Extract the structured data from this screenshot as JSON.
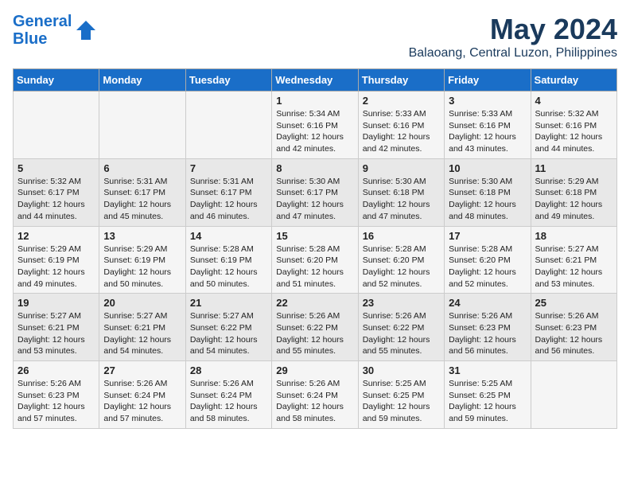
{
  "header": {
    "logo_line1": "General",
    "logo_line2": "Blue",
    "month": "May 2024",
    "location": "Balaoang, Central Luzon, Philippines"
  },
  "days_of_week": [
    "Sunday",
    "Monday",
    "Tuesday",
    "Wednesday",
    "Thursday",
    "Friday",
    "Saturday"
  ],
  "weeks": [
    [
      {
        "num": "",
        "info": ""
      },
      {
        "num": "",
        "info": ""
      },
      {
        "num": "",
        "info": ""
      },
      {
        "num": "1",
        "info": "Sunrise: 5:34 AM\nSunset: 6:16 PM\nDaylight: 12 hours\nand 42 minutes."
      },
      {
        "num": "2",
        "info": "Sunrise: 5:33 AM\nSunset: 6:16 PM\nDaylight: 12 hours\nand 42 minutes."
      },
      {
        "num": "3",
        "info": "Sunrise: 5:33 AM\nSunset: 6:16 PM\nDaylight: 12 hours\nand 43 minutes."
      },
      {
        "num": "4",
        "info": "Sunrise: 5:32 AM\nSunset: 6:16 PM\nDaylight: 12 hours\nand 44 minutes."
      }
    ],
    [
      {
        "num": "5",
        "info": "Sunrise: 5:32 AM\nSunset: 6:17 PM\nDaylight: 12 hours\nand 44 minutes."
      },
      {
        "num": "6",
        "info": "Sunrise: 5:31 AM\nSunset: 6:17 PM\nDaylight: 12 hours\nand 45 minutes."
      },
      {
        "num": "7",
        "info": "Sunrise: 5:31 AM\nSunset: 6:17 PM\nDaylight: 12 hours\nand 46 minutes."
      },
      {
        "num": "8",
        "info": "Sunrise: 5:30 AM\nSunset: 6:17 PM\nDaylight: 12 hours\nand 47 minutes."
      },
      {
        "num": "9",
        "info": "Sunrise: 5:30 AM\nSunset: 6:18 PM\nDaylight: 12 hours\nand 47 minutes."
      },
      {
        "num": "10",
        "info": "Sunrise: 5:30 AM\nSunset: 6:18 PM\nDaylight: 12 hours\nand 48 minutes."
      },
      {
        "num": "11",
        "info": "Sunrise: 5:29 AM\nSunset: 6:18 PM\nDaylight: 12 hours\nand 49 minutes."
      }
    ],
    [
      {
        "num": "12",
        "info": "Sunrise: 5:29 AM\nSunset: 6:19 PM\nDaylight: 12 hours\nand 49 minutes."
      },
      {
        "num": "13",
        "info": "Sunrise: 5:29 AM\nSunset: 6:19 PM\nDaylight: 12 hours\nand 50 minutes."
      },
      {
        "num": "14",
        "info": "Sunrise: 5:28 AM\nSunset: 6:19 PM\nDaylight: 12 hours\nand 50 minutes."
      },
      {
        "num": "15",
        "info": "Sunrise: 5:28 AM\nSunset: 6:20 PM\nDaylight: 12 hours\nand 51 minutes."
      },
      {
        "num": "16",
        "info": "Sunrise: 5:28 AM\nSunset: 6:20 PM\nDaylight: 12 hours\nand 52 minutes."
      },
      {
        "num": "17",
        "info": "Sunrise: 5:28 AM\nSunset: 6:20 PM\nDaylight: 12 hours\nand 52 minutes."
      },
      {
        "num": "18",
        "info": "Sunrise: 5:27 AM\nSunset: 6:21 PM\nDaylight: 12 hours\nand 53 minutes."
      }
    ],
    [
      {
        "num": "19",
        "info": "Sunrise: 5:27 AM\nSunset: 6:21 PM\nDaylight: 12 hours\nand 53 minutes."
      },
      {
        "num": "20",
        "info": "Sunrise: 5:27 AM\nSunset: 6:21 PM\nDaylight: 12 hours\nand 54 minutes."
      },
      {
        "num": "21",
        "info": "Sunrise: 5:27 AM\nSunset: 6:22 PM\nDaylight: 12 hours\nand 54 minutes."
      },
      {
        "num": "22",
        "info": "Sunrise: 5:26 AM\nSunset: 6:22 PM\nDaylight: 12 hours\nand 55 minutes."
      },
      {
        "num": "23",
        "info": "Sunrise: 5:26 AM\nSunset: 6:22 PM\nDaylight: 12 hours\nand 55 minutes."
      },
      {
        "num": "24",
        "info": "Sunrise: 5:26 AM\nSunset: 6:23 PM\nDaylight: 12 hours\nand 56 minutes."
      },
      {
        "num": "25",
        "info": "Sunrise: 5:26 AM\nSunset: 6:23 PM\nDaylight: 12 hours\nand 56 minutes."
      }
    ],
    [
      {
        "num": "26",
        "info": "Sunrise: 5:26 AM\nSunset: 6:23 PM\nDaylight: 12 hours\nand 57 minutes."
      },
      {
        "num": "27",
        "info": "Sunrise: 5:26 AM\nSunset: 6:24 PM\nDaylight: 12 hours\nand 57 minutes."
      },
      {
        "num": "28",
        "info": "Sunrise: 5:26 AM\nSunset: 6:24 PM\nDaylight: 12 hours\nand 58 minutes."
      },
      {
        "num": "29",
        "info": "Sunrise: 5:26 AM\nSunset: 6:24 PM\nDaylight: 12 hours\nand 58 minutes."
      },
      {
        "num": "30",
        "info": "Sunrise: 5:25 AM\nSunset: 6:25 PM\nDaylight: 12 hours\nand 59 minutes."
      },
      {
        "num": "31",
        "info": "Sunrise: 5:25 AM\nSunset: 6:25 PM\nDaylight: 12 hours\nand 59 minutes."
      },
      {
        "num": "",
        "info": ""
      }
    ]
  ]
}
